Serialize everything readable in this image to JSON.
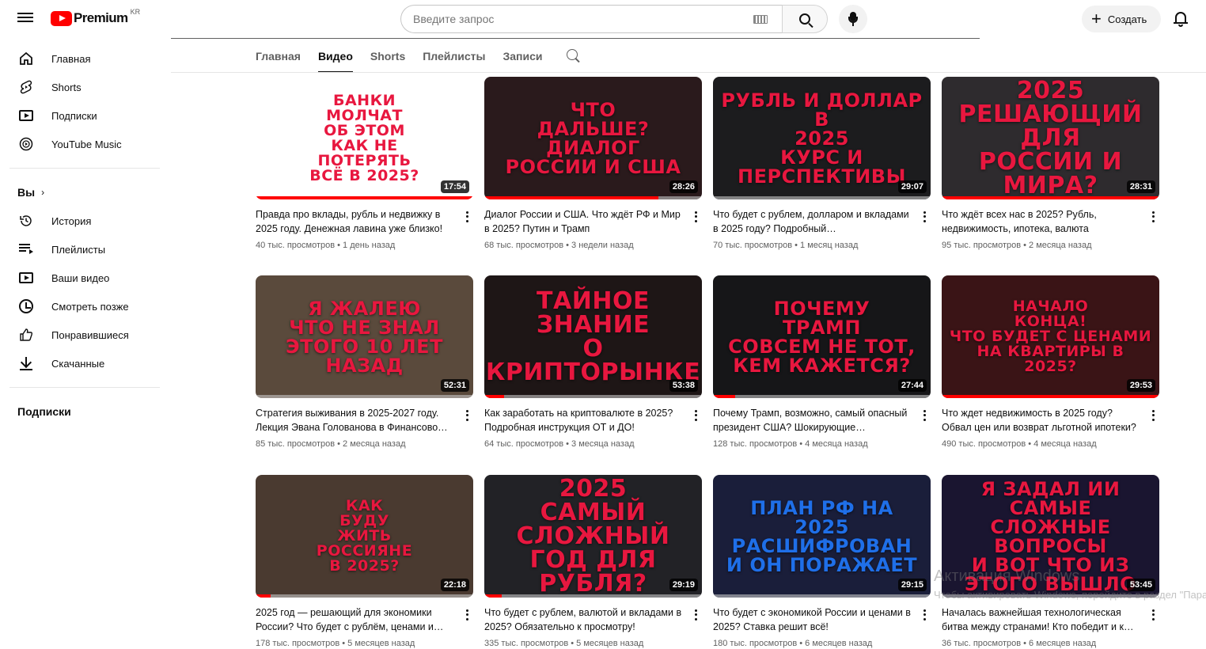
{
  "header": {
    "logo_text": "Premium",
    "logo_region": "KR",
    "search_placeholder": "Введите запрос",
    "create_label": "Создать",
    "icons": [
      "menu-icon",
      "keyboard-icon",
      "search-icon",
      "mic-icon",
      "plus-icon",
      "bell-icon"
    ]
  },
  "sidebar": {
    "main": [
      {
        "label": "Главная",
        "icon": "home-icon"
      },
      {
        "label": "Shorts",
        "icon": "shorts-icon"
      },
      {
        "label": "Подписки",
        "icon": "subscriptions-icon"
      },
      {
        "label": "YouTube Music",
        "icon": "music-icon"
      }
    ],
    "you_label": "Вы",
    "you": [
      {
        "label": "История",
        "icon": "history-icon"
      },
      {
        "label": "Плейлисты",
        "icon": "playlists-icon"
      },
      {
        "label": "Ваши видео",
        "icon": "your-videos-icon"
      },
      {
        "label": "Смотреть позже",
        "icon": "watch-later-icon"
      },
      {
        "label": "Понравившиеся",
        "icon": "like-icon"
      },
      {
        "label": "Скачанные",
        "icon": "download-icon"
      }
    ],
    "subs_label": "Подписки"
  },
  "tabs": [
    {
      "label": "Главная",
      "active": false
    },
    {
      "label": "Видео",
      "active": true
    },
    {
      "label": "Shorts",
      "active": false
    },
    {
      "label": "Плейлисты",
      "active": false
    },
    {
      "label": "Записи",
      "active": false
    }
  ],
  "videos": [
    {
      "thumb_text": "БАНКИ\nМОЛЧАТ\nОБ ЭТОМ\nКАК НЕ\nПОТЕРЯТЬ\nВСЁ В 2025?",
      "duration": "17:54",
      "progress": 1.0,
      "title": "Правда про вклады, рубль и недвижку в 2025 году. Денежная лавина уже близко!",
      "meta": "40 тыс. просмотров • 1 день назад",
      "bg": "#ffffff",
      "fg": "#e8173f",
      "fg2": "#111111"
    },
    {
      "thumb_text": "ЧТО\nДАЛЬШЕ?\nДИАЛОГ\nРОССИИ И США",
      "duration": "28:26",
      "progress": 0.8,
      "title": "Диалог России и США. Что ждёт РФ и Мир в 2025? Путин и Трамп",
      "meta": "68 тыс. просмотров • 3 недели назад",
      "bg": "#2a1a1c",
      "fg": "#e8173f",
      "fg2": "#ffffff"
    },
    {
      "thumb_text": "РУБЛЬ И ДОЛЛАР В\n2025\nКУРС И\nПЕРСПЕКТИВЫ",
      "duration": "29:07",
      "progress": 0.0,
      "title": "Что будет с рублем, долларом и вкладами в 2025 году? Подробный…",
      "meta": "70 тыс. просмотров • 1 месяц назад",
      "bg": "#1c1c1e",
      "fg": "#e8173f",
      "fg2": "#ffffff"
    },
    {
      "thumb_text": "2025\nРЕШАЮЩИЙ ДЛЯ\nРОССИИ И МИРА?",
      "duration": "28:31",
      "progress": 1.0,
      "title": "Что ждёт всех нас в 2025? Рубль, недвижимость, ипотека, валюта",
      "meta": "95 тыс. просмотров • 2 месяца назад",
      "bg": "#2e2b2e",
      "fg": "#e8173f",
      "fg2": "#ffffff"
    },
    {
      "thumb_text": "Я ЖАЛЕЮ\nЧТО НЕ ЗНАЛ\nЭТОГО 10 ЛЕТ\nНАЗАД",
      "duration": "52:31",
      "progress": 0.0,
      "title": "Стратегия выживания в 2025-2027 году. Лекция Эвана Голованова в Финансово…",
      "meta": "85 тыс. просмотров • 2 месяца назад",
      "bg": "#5a4a3c",
      "fg": "#e8173f",
      "fg2": "#ffffff"
    },
    {
      "thumb_text": "ТАЙНОЕ\nЗНАНИЕ\nО КРИПТОРЫНКЕ",
      "duration": "53:38",
      "progress": 0.09,
      "title": "Как заработать на криптовалюте в 2025? Подробная инструкция ОТ и ДО!",
      "meta": "64 тыс. просмотров • 3 месяца назад",
      "bg": "#1e1616",
      "fg": "#e8173f",
      "fg2": "#ffffff"
    },
    {
      "thumb_text": "ПОЧЕМУ\nТРАМП\nСОВСЕМ НЕ ТОТ,\nКЕМ КАЖЕТСЯ?",
      "duration": "27:44",
      "progress": 0.1,
      "title": "Почему Трамп, возможно, самый опасный президент США? Шокирующие…",
      "meta": "128 тыс. просмотров • 4 месяца назад",
      "bg": "#161618",
      "fg": "#e8173f",
      "fg2": "#ffffff"
    },
    {
      "thumb_text": "НАЧАЛО\nКОНЦА!\nЧТО БУДЕТ С ЦЕНАМИ\nНА КВАРТИРЫ В\n2025?",
      "duration": "29:53",
      "progress": 1.0,
      "title": "Что ждет недвижимость в 2025 году? Обвал цен или возврат льготной ипотеки?",
      "meta": "490 тыс. просмотров • 4 месяца назад",
      "bg": "#3a1416",
      "fg": "#e8173f",
      "fg2": "#ffffff"
    },
    {
      "thumb_text": "КАК\nБУДУ\nЖИТЬ\nРОССИЯНЕ\nВ 2025?",
      "duration": "22:18",
      "progress": 0.07,
      "title": "2025 год — решающий для экономики России? Что будет с рублём, ценами и…",
      "meta": "178 тыс. просмотров • 5 месяцев назад",
      "bg": "#4a3a30",
      "fg": "#e8173f",
      "fg2": "#ffffff"
    },
    {
      "thumb_text": "2025\nСАМЫЙ СЛОЖНЫЙ\nГОД ДЛЯ РУБЛЯ?",
      "duration": "29:19",
      "progress": 0.08,
      "title": "Что будет с рублем, валютой и вкладами в 2025? Обязательно к просмотру!",
      "meta": "335 тыс. просмотров • 5 месяцев назад",
      "bg": "#222226",
      "fg": "#e8173f",
      "fg2": "#ffffff"
    },
    {
      "thumb_text": "ПЛАН РФ НА\n2025\nРАСШИФРОВАН\nИ ОН ПОРАЖАЕТ",
      "duration": "29:15",
      "progress": 0.0,
      "title": "Что будет с экономикой России и ценами в 2025? Ставка решит всё!",
      "meta": "180 тыс. просмотров • 6 месяцев назад",
      "bg": "#1a1e3a",
      "fg": "#1f6fe8",
      "fg2": "#e8173f"
    },
    {
      "thumb_text": "Я ЗАДАЛ ИИ САМЫЕ\nСЛОЖНЫЕ ВОПРОСЫ\nИ ВОТ ЧТО ИЗ\nЭТОГО ВЫШЛО",
      "duration": "53:45",
      "progress": 0.0,
      "title": "Началась важнейшая технологическая битва между странами! Кто победит и к…",
      "meta": "36 тыс. просмотров • 6 месяцев назад",
      "bg": "#1a1530",
      "fg": "#e8173f",
      "fg2": "#ffffff"
    }
  ],
  "watermark": {
    "line1": "Активация Windows",
    "line2": "Чтобы активировать Windows, перейдите в раздел \"Параметры\"."
  }
}
